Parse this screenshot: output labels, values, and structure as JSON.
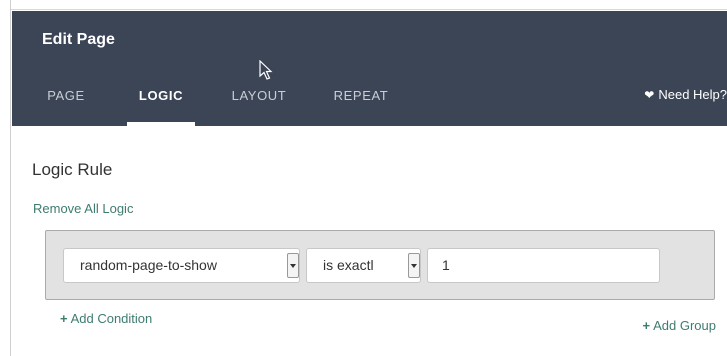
{
  "header": {
    "title": "Edit Page",
    "tabs": [
      {
        "label": "PAGE",
        "active": false
      },
      {
        "label": "LOGIC",
        "active": true
      },
      {
        "label": "LAYOUT",
        "active": false
      },
      {
        "label": "REPEAT",
        "active": false
      }
    ],
    "help_label": "Need Help?",
    "help_icon": "heart-icon"
  },
  "logic": {
    "section_title": "Logic Rule",
    "remove_all_label": "Remove All Logic",
    "condition": {
      "field_select_value": "random-page-to-show",
      "operator_select_value": "is exactl",
      "value_input": "1"
    },
    "add_condition_label": "Add Condition",
    "add_group_label": "Add Group",
    "plus_icon": "plus-icon"
  },
  "colors": {
    "header_bg": "#3c4556",
    "link_green": "#3e7c6f",
    "group_bg": "#e2e2e2"
  }
}
